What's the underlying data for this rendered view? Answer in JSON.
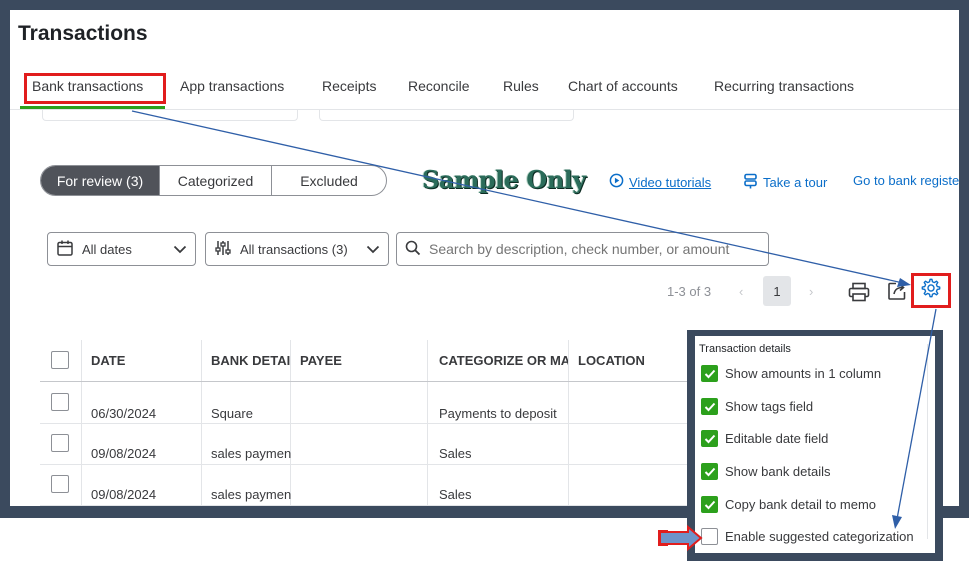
{
  "page": {
    "title": "Transactions"
  },
  "tabs": [
    {
      "label": "Bank transactions",
      "active": true
    },
    {
      "label": "App transactions"
    },
    {
      "label": "Receipts"
    },
    {
      "label": "Reconcile"
    },
    {
      "label": "Rules"
    },
    {
      "label": "Chart of accounts"
    },
    {
      "label": "Recurring transactions"
    }
  ],
  "review_tabs": [
    {
      "label": "For review (3)",
      "active": true
    },
    {
      "label": "Categorized"
    },
    {
      "label": "Excluded"
    }
  ],
  "watermark": "Sample Only",
  "links": {
    "video": "Video tutorials",
    "tour": "Take a tour",
    "register": "Go to bank registe"
  },
  "filters": {
    "dates": "All dates",
    "transactions": "All transactions (3)",
    "search_placeholder": "Search by description, check number, or amount"
  },
  "pagination": {
    "range": "1-3 of 3",
    "current_page": "1",
    "prev": "‹",
    "next": "›"
  },
  "table": {
    "headers": [
      "DATE",
      "BANK DETAI",
      "PAYEE",
      "CATEGORIZE OR MA",
      "LOCATION"
    ],
    "rows": [
      {
        "date": "06/30/2024",
        "bank_detail": "Square",
        "payee": "",
        "category": "Payments to deposit",
        "location": ""
      },
      {
        "date": "09/08/2024",
        "bank_detail": "sales paymen",
        "payee": "",
        "category": "Sales",
        "location": ""
      },
      {
        "date": "09/08/2024",
        "bank_detail": "sales paymen",
        "payee": "",
        "category": "Sales",
        "location": ""
      }
    ]
  },
  "settings_panel": {
    "title": "Transaction details",
    "options": [
      {
        "label": "Show amounts in 1 column",
        "checked": true
      },
      {
        "label": "Show tags field",
        "checked": true
      },
      {
        "label": "Editable date field",
        "checked": true
      },
      {
        "label": "Show bank details",
        "checked": true
      },
      {
        "label": "Copy bank detail to memo",
        "checked": true
      },
      {
        "label": "Enable suggested categorization",
        "checked": false
      }
    ]
  },
  "colors": {
    "frame": "#3b4a5e",
    "highlight": "#e11d1d",
    "accent_green": "#2ca01c",
    "link_blue": "#0b6ec9",
    "arrow_blue": "#2f5fa8",
    "pointer_arrow": "#6d93c9"
  },
  "icons": {
    "calendar": "calendar-icon",
    "filter": "sliders-icon",
    "search": "search-icon",
    "print": "print-icon",
    "export": "export-icon",
    "settings": "gear-icon",
    "video": "play-circle-icon",
    "tour": "tour-icon"
  }
}
